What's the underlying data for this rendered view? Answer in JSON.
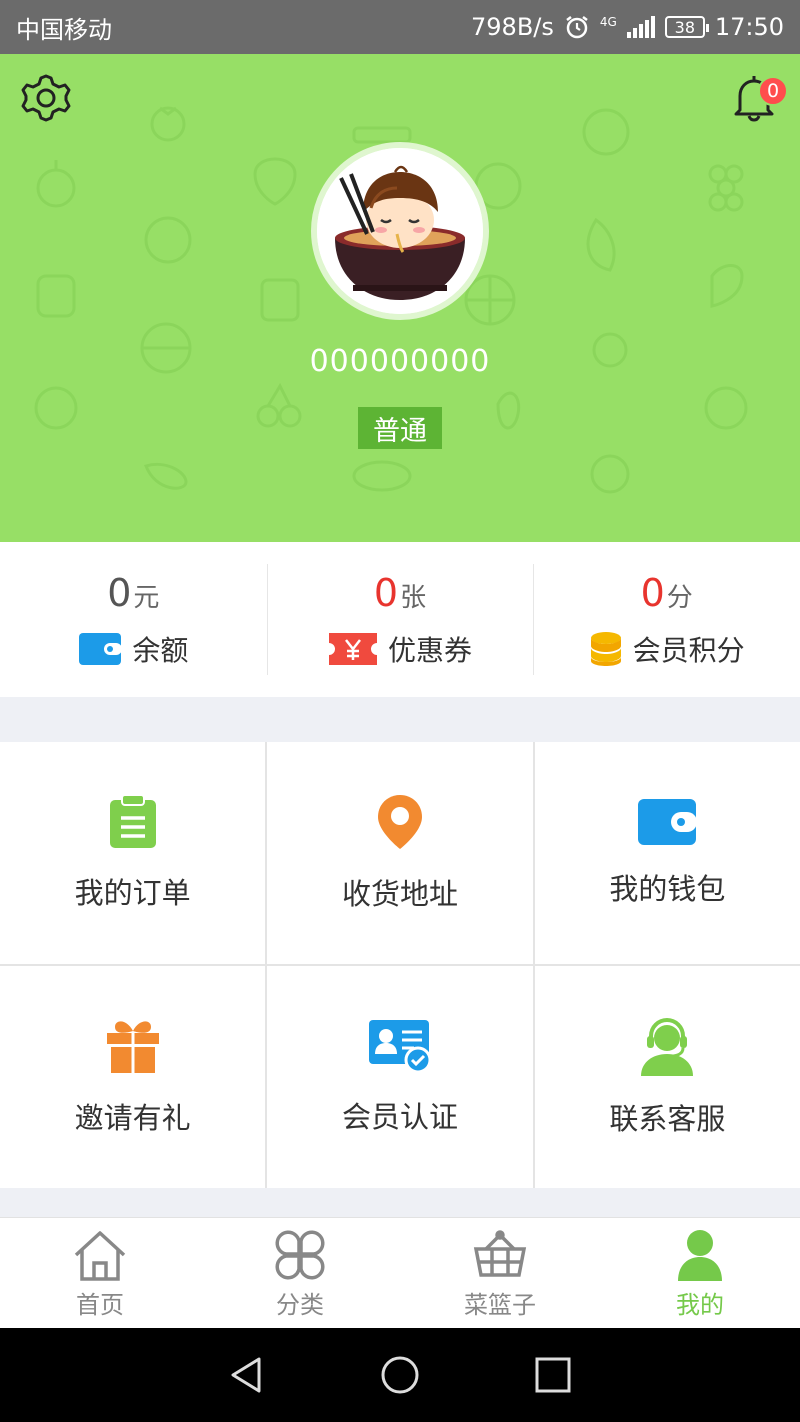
{
  "status_bar": {
    "carrier": "中国移动",
    "speed": "798B/s",
    "network": "4G",
    "battery": "38",
    "time": "17:50"
  },
  "header": {
    "notification_count": "0",
    "username": "000000000",
    "level": "普通"
  },
  "stats": [
    {
      "value": "0",
      "unit": "元",
      "label": "余额",
      "value_color": "#555555",
      "icon": "wallet-icon"
    },
    {
      "value": "0",
      "unit": "张",
      "label": "优惠券",
      "value_color": "#e8342e",
      "icon": "coupon-icon"
    },
    {
      "value": "0",
      "unit": "分",
      "label": "会员积分",
      "value_color": "#e8342e",
      "icon": "coins-icon"
    }
  ],
  "menu": [
    {
      "label": "我的订单",
      "icon": "clipboard-icon"
    },
    {
      "label": "收货地址",
      "icon": "location-pin-icon"
    },
    {
      "label": "我的钱包",
      "icon": "wallet-icon"
    },
    {
      "label": "邀请有礼",
      "icon": "gift-icon"
    },
    {
      "label": "会员认证",
      "icon": "id-card-verified-icon"
    },
    {
      "label": "联系客服",
      "icon": "customer-service-icon"
    }
  ],
  "tabs": [
    {
      "label": "首页",
      "icon": "home-icon"
    },
    {
      "label": "分类",
      "icon": "category-icon"
    },
    {
      "label": "菜篮子",
      "icon": "basket-icon"
    },
    {
      "label": "我的",
      "icon": "user-icon",
      "active": true
    }
  ],
  "colors": {
    "header_green": "#97df66",
    "accent_green": "#75c94a",
    "red": "#e8342e",
    "orange": "#f28a30",
    "blue": "#1c9be8",
    "gold": "#f5b800"
  }
}
